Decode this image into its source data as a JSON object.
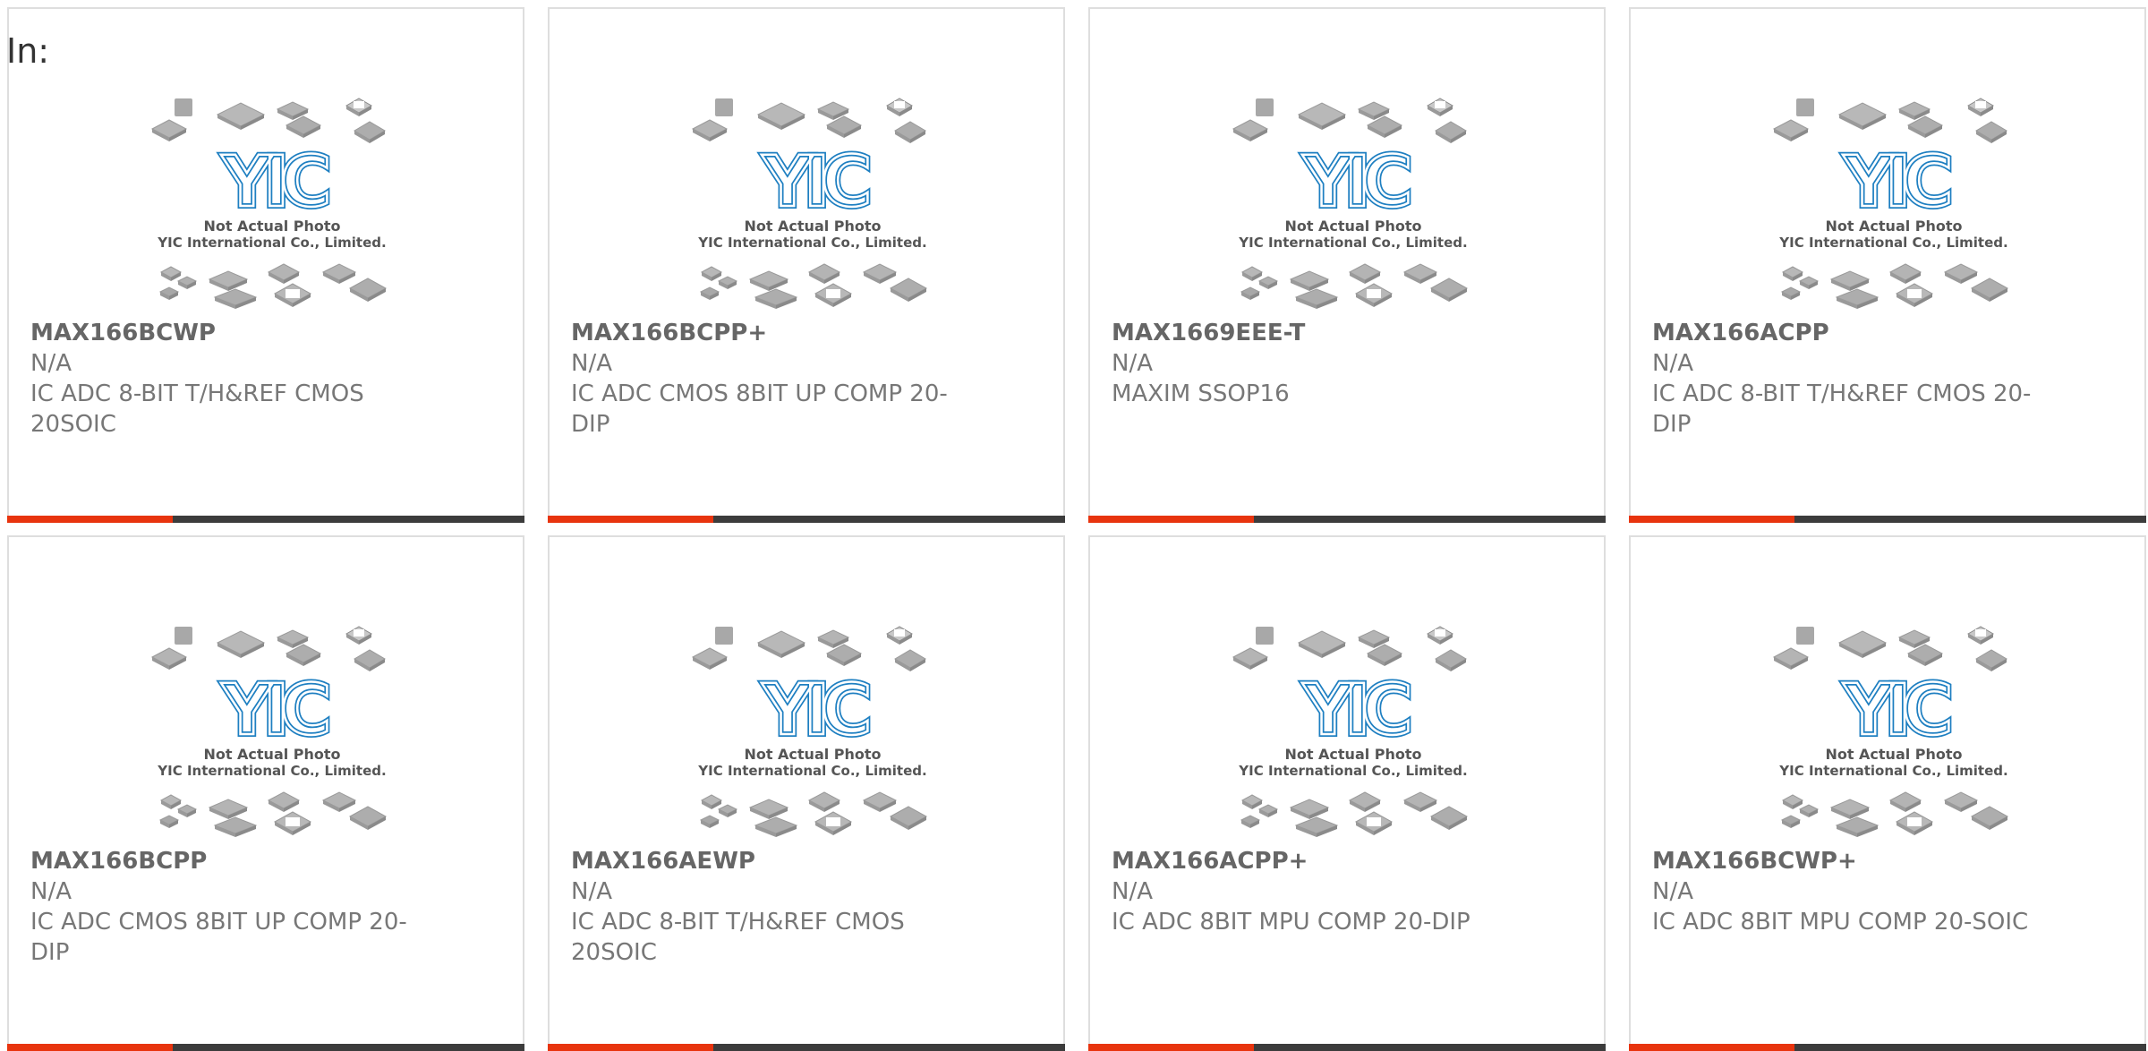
{
  "page": {
    "label": "In:"
  },
  "placeholder_image": {
    "logo_text": "YIC",
    "caption_line1": "Not Actual Photo",
    "caption_line2": "YIC International Co., Limited.",
    "icon": "chip-package-icons"
  },
  "colors": {
    "accent": "#e8340e",
    "bar": "#3c3c3c",
    "border": "#dedede",
    "logo_blue": "#1e7fc1"
  },
  "products": [
    {
      "part_number": "MAX166BCWP",
      "manufacturer": "N/A",
      "description": "IC ADC 8-BIT T/H&REF CMOS 20SOIC"
    },
    {
      "part_number": "MAX166BCPP+",
      "manufacturer": "N/A",
      "description": "IC ADC CMOS 8BIT UP COMP 20-DIP"
    },
    {
      "part_number": "MAX1669EEE-T",
      "manufacturer": "N/A",
      "description": "MAXIM SSOP16"
    },
    {
      "part_number": "MAX166ACPP",
      "manufacturer": "N/A",
      "description": "IC ADC 8-BIT T/H&REF CMOS 20-DIP"
    },
    {
      "part_number": "MAX166BCPP",
      "manufacturer": "N/A",
      "description": "IC ADC CMOS 8BIT UP COMP 20-DIP"
    },
    {
      "part_number": "MAX166AEWP",
      "manufacturer": "N/A",
      "description": "IC ADC 8-BIT T/H&REF CMOS 20SOIC"
    },
    {
      "part_number": "MAX166ACPP+",
      "manufacturer": "N/A",
      "description": "IC ADC 8BIT MPU COMP 20-DIP"
    },
    {
      "part_number": "MAX166BCWP+",
      "manufacturer": "N/A",
      "description": "IC ADC 8BIT MPU COMP 20-SOIC"
    }
  ]
}
